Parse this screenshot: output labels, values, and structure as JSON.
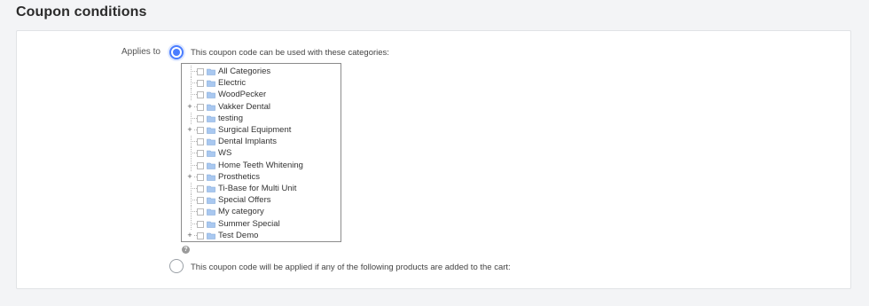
{
  "section": {
    "title": "Coupon conditions"
  },
  "applies_to": {
    "label": "Applies to",
    "option_categories": "This coupon code can be used with these categories:",
    "option_products": "This coupon code will be applied if any of the following products are added to the cart:",
    "selected": "categories"
  },
  "category_tree": {
    "items": [
      {
        "label": "All Categories",
        "expandable": false,
        "checked": false
      },
      {
        "label": "Electric",
        "expandable": false,
        "checked": false
      },
      {
        "label": "WoodPecker",
        "expandable": false,
        "checked": false
      },
      {
        "label": "Vakker Dental",
        "expandable": true,
        "checked": false
      },
      {
        "label": "testing",
        "expandable": false,
        "checked": false
      },
      {
        "label": "Surgical Equipment",
        "expandable": true,
        "checked": false
      },
      {
        "label": "Dental Implants",
        "expandable": false,
        "checked": false
      },
      {
        "label": "WS",
        "expandable": false,
        "checked": false
      },
      {
        "label": "Home Teeth Whitening",
        "expandable": false,
        "checked": false
      },
      {
        "label": "Prosthetics",
        "expandable": true,
        "checked": false
      },
      {
        "label": "Ti-Base for Multi Unit",
        "expandable": false,
        "checked": false
      },
      {
        "label": "Special Offers",
        "expandable": false,
        "checked": false
      },
      {
        "label": "My category",
        "expandable": false,
        "checked": false
      },
      {
        "label": "Summer Special",
        "expandable": false,
        "checked": false
      },
      {
        "label": "Test Demo",
        "expandable": true,
        "checked": false
      }
    ],
    "expander_glyph": "+"
  },
  "help": {
    "glyph": "?"
  },
  "colors": {
    "accent": "#4a7dff",
    "folder": "#a9c8f0"
  }
}
